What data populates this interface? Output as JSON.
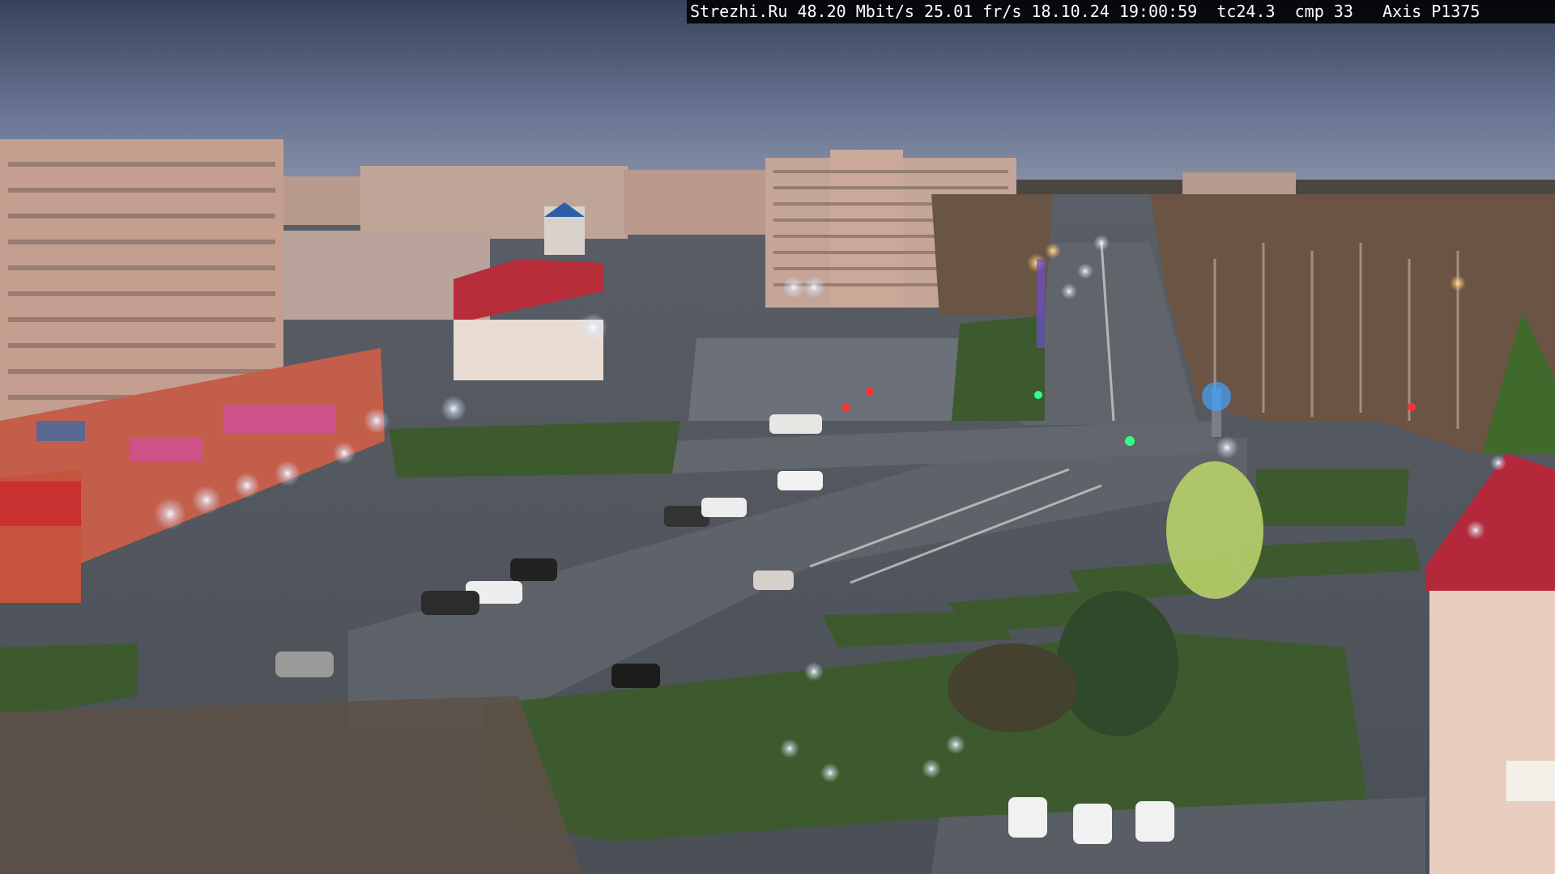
{
  "overlay": {
    "site": "Strezhi.Ru",
    "bitrate": "48.20 Mbit/s",
    "framerate": "25.01 fr/s",
    "datetime": "18.10.24 19:00:59",
    "tc": "tc24.3",
    "cmp": "cmp 33",
    "camera": "Axis P1375"
  },
  "colors": {
    "sky_top": "#3f4a5e",
    "sky_bottom": "#7e8aa6",
    "road": "#5c6068",
    "grass": "#3b5a2c",
    "building_pink": "#c79c8c",
    "red_roof": "#b72d3a"
  }
}
